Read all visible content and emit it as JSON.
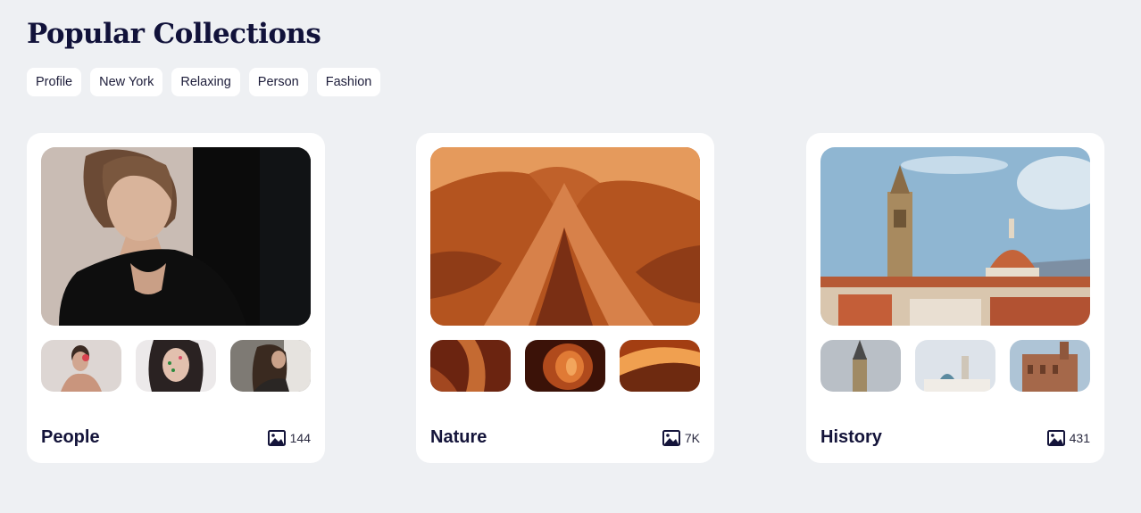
{
  "page": {
    "title": "Popular Collections"
  },
  "tags": [
    "Profile",
    "New York",
    "Relaxing",
    "Person",
    "Fashion"
  ],
  "collections": [
    {
      "title": "People",
      "count": "144",
      "icon": "image-icon"
    },
    {
      "title": "Nature",
      "count": "7K",
      "icon": "image-icon"
    },
    {
      "title": "History",
      "count": "431",
      "icon": "image-icon"
    }
  ],
  "colors": {
    "background": "#eef0f3",
    "card": "#ffffff",
    "text": "#14143a"
  }
}
